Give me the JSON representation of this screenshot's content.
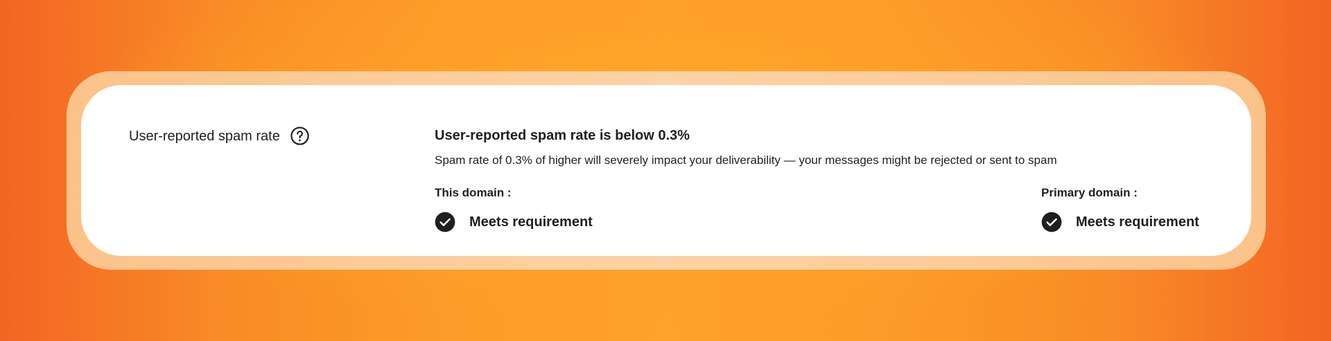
{
  "metric": {
    "label": "User-reported spam rate",
    "help_icon": "help-circle-icon"
  },
  "result": {
    "headline": "User-reported spam rate is below 0.3%",
    "description": "Spam rate of 0.3% of higher will severely impact your deliverability — your messages might be rejected or sent to spam"
  },
  "domains": {
    "this_domain": {
      "title": "This domain :",
      "status": "Meets requirement",
      "status_icon": "check-circle-icon"
    },
    "primary_domain": {
      "title": "Primary domain :",
      "status": "Meets requirement",
      "status_icon": "check-circle-icon"
    }
  },
  "colors": {
    "background_orange": "#fea22a",
    "background_edge": "#f26524",
    "card": "#ffffff",
    "card_border": "#fcd3a6",
    "text": "#1f1f1f",
    "status_icon": "#1f1f1f"
  }
}
